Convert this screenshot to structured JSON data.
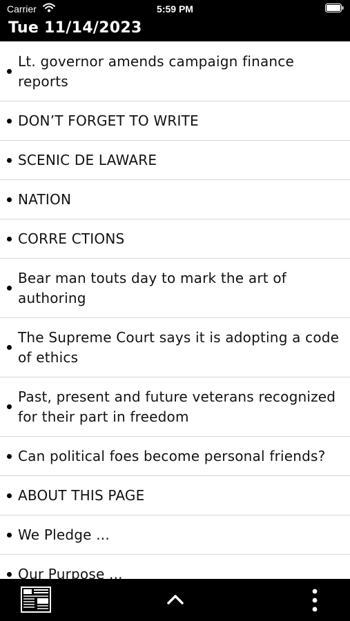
{
  "status_bar": {
    "carrier": "Carrier",
    "time": "5:59 PM",
    "wifi_icon": "wifi-icon",
    "battery_icon": "battery-icon"
  },
  "header": {
    "date": "Tue 11/14/2023"
  },
  "articles": [
    "Lt. governor amends campaign finance reports",
    "DON’T FORGET TO WRITE",
    "SCENIC DE LAWARE",
    "NATION",
    "CORRE CTIONS",
    "Bear man touts day to mark the art of authoring",
    "The Supreme Court says it is adopting a code of ethics",
    "Past, present and future veterans recognized for their part in freedom",
    "Can political foes become personal friends?",
    "ABOUT THIS PAGE",
    "We Pledge ...",
    "Our Purpose ..."
  ],
  "bottom_bar": {
    "left_icon": "newspaper-icon",
    "center_icon": "chevron-up-icon",
    "right_icon": "more-vertical-icon"
  },
  "colors": {
    "bar_background": "#000000",
    "list_background": "#ffffff",
    "divider": "#d6d6d6",
    "text": "#111111"
  }
}
